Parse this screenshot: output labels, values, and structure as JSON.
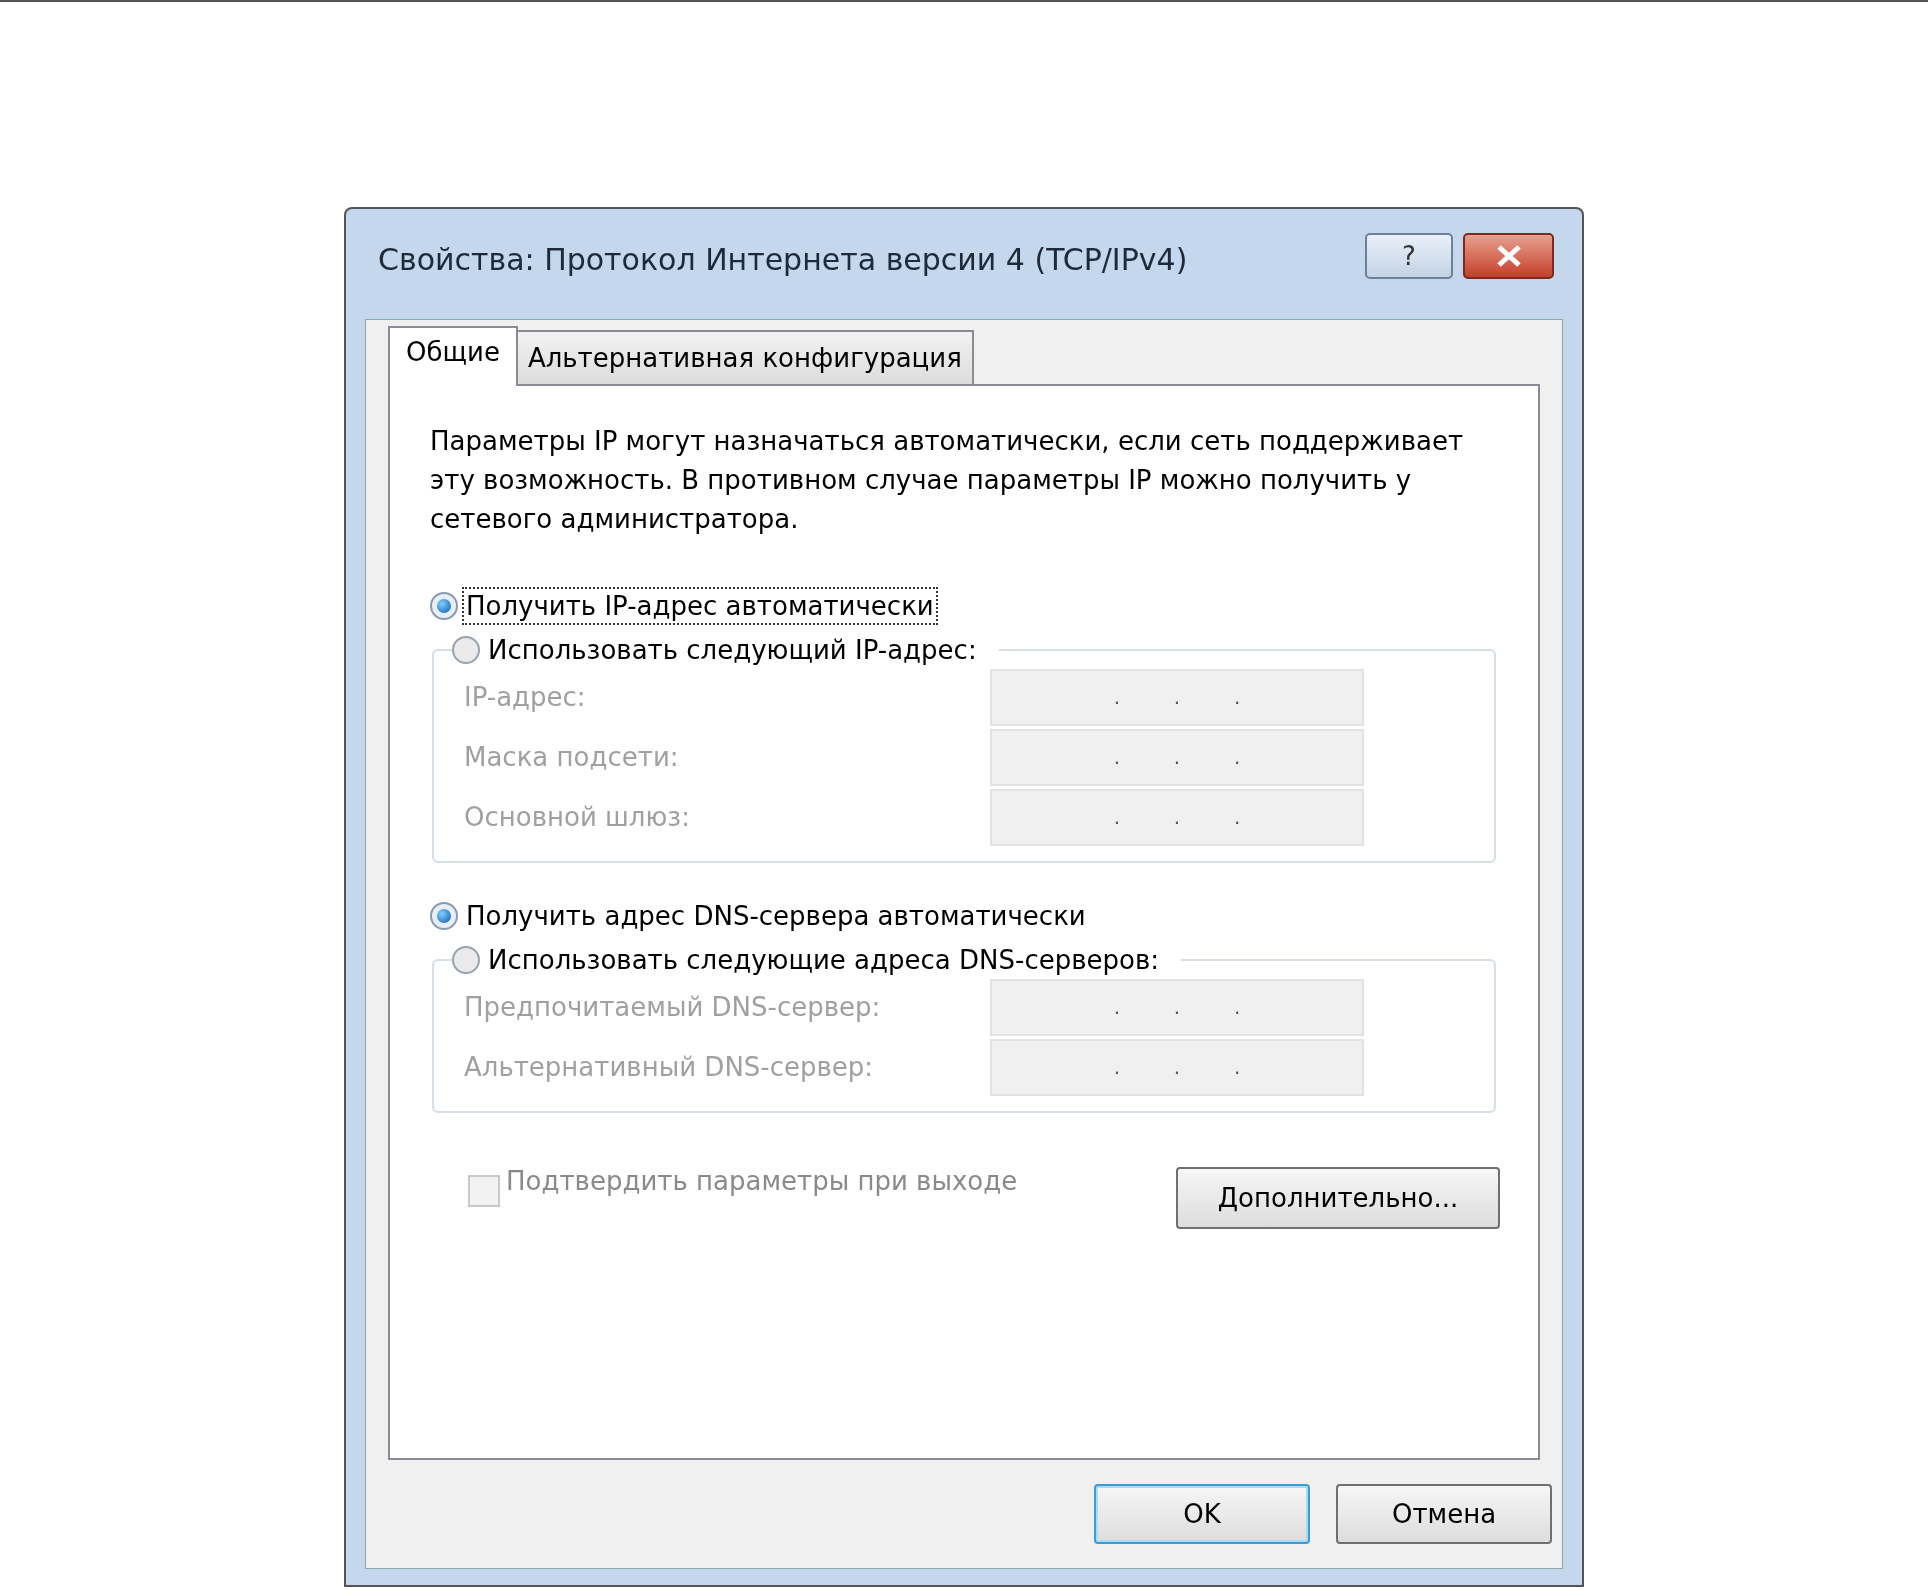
{
  "window": {
    "title": "Свойства: Протокол Интернета версии 4 (TCP/IPv4)",
    "help_button": "?"
  },
  "tabs": [
    {
      "label": "Общие",
      "selected": true
    },
    {
      "label": "Альтернативная конфигурация",
      "selected": false
    }
  ],
  "description": "Параметры IP могут назначаться автоматически, если сеть поддерживает эту возможность. В противном случае параметры IP можно получить у сетевого администратора.",
  "ip_section": {
    "radios": [
      {
        "label": "Получить IP-адрес автоматически",
        "selected": true,
        "focused": true
      },
      {
        "label": "Использовать следующий IP-адрес:",
        "selected": false,
        "focused": false
      }
    ],
    "fields": [
      {
        "label": "IP-адрес:",
        "disabled": true,
        "separators": [
          ".",
          ".",
          "."
        ]
      },
      {
        "label": "Маска подсети:",
        "disabled": true,
        "separators": [
          ".",
          ".",
          "."
        ]
      },
      {
        "label": "Основной шлюз:",
        "disabled": true,
        "separators": [
          ".",
          ".",
          "."
        ]
      }
    ]
  },
  "dns_section": {
    "radios": [
      {
        "label": "Получить адрес DNS-сервера автоматически",
        "selected": true,
        "focused": false
      },
      {
        "label": "Использовать следующие адреса DNS-серверов:",
        "selected": false,
        "focused": false
      }
    ],
    "fields": [
      {
        "label": "Предпочитаемый DNS-сервер:",
        "disabled": true,
        "separators": [
          ".",
          ".",
          "."
        ]
      },
      {
        "label": "Альтернативный DNS-сервер:",
        "disabled": true,
        "separators": [
          ".",
          ".",
          "."
        ]
      }
    ]
  },
  "confirm_checkbox": {
    "label": "Подтвердить параметры при выходе",
    "checked": false,
    "disabled": true
  },
  "advanced_button": "Дополнительно...",
  "buttons": [
    {
      "label": "OK",
      "default": true
    },
    {
      "label": "Отмена",
      "default": false
    }
  ]
}
